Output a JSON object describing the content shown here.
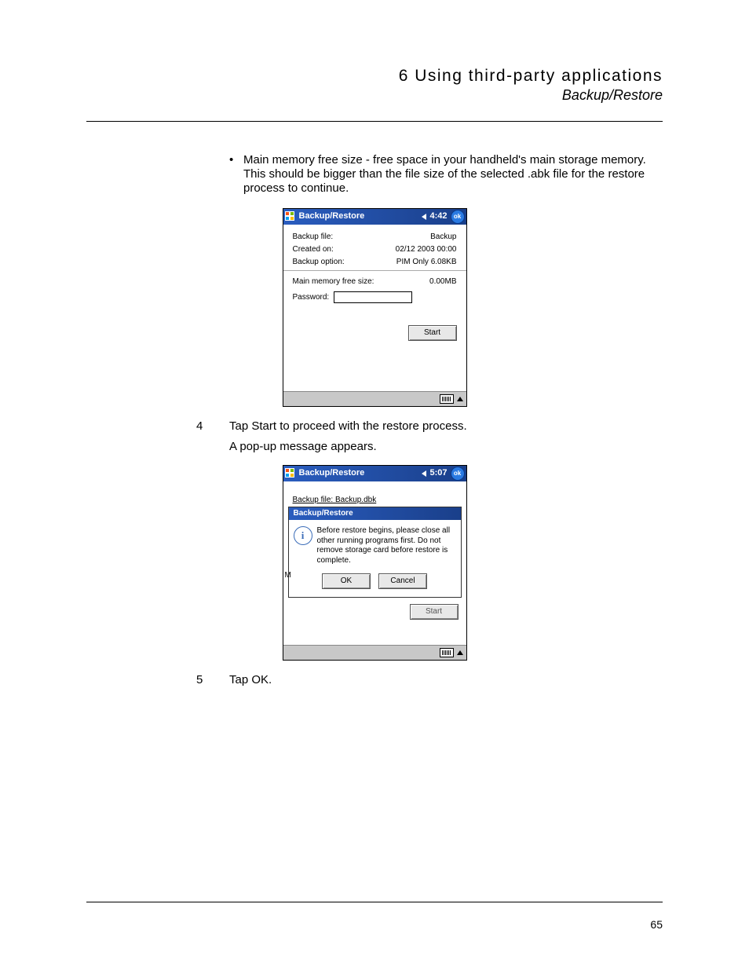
{
  "header": {
    "chapter": "6 Using third-party applications",
    "section": "Backup/Restore"
  },
  "bullet": {
    "text": "Main memory free size - free space in your handheld's main storage memory. This should be bigger than the file size of the selected .abk file for the restore process to continue."
  },
  "screenshot1": {
    "title": "Backup/Restore",
    "time": "4:42",
    "ok": "ok",
    "rows": {
      "bf_label": "Backup file:",
      "bf_value": "Backup",
      "co_label": "Created on:",
      "co_value": "02/12 2003 00:00",
      "bo_label": "Backup option:",
      "bo_value": "PIM Only   6.08KB",
      "mm_label": "Main memory free size:",
      "mm_value": "0.00MB",
      "pw_label": "Password:"
    },
    "start_btn": "Start"
  },
  "step4": {
    "num": "4",
    "line1": "Tap Start to proceed with the restore process.",
    "line2": "A pop-up message appears."
  },
  "screenshot2": {
    "title": "Backup/Restore",
    "time": "5:07",
    "ok": "ok",
    "backline": "Backup file: Backup.dbk",
    "dialog": {
      "title": "Backup/Restore",
      "msg": "Before restore begins, please close all other running programs first. Do not remove storage card before restore is complete.",
      "ok_btn": "OK",
      "cancel_btn": "Cancel"
    },
    "letter_m": "M",
    "start_btn": "Start"
  },
  "step5": {
    "num": "5",
    "line1": "Tap OK."
  },
  "page_number": "65"
}
